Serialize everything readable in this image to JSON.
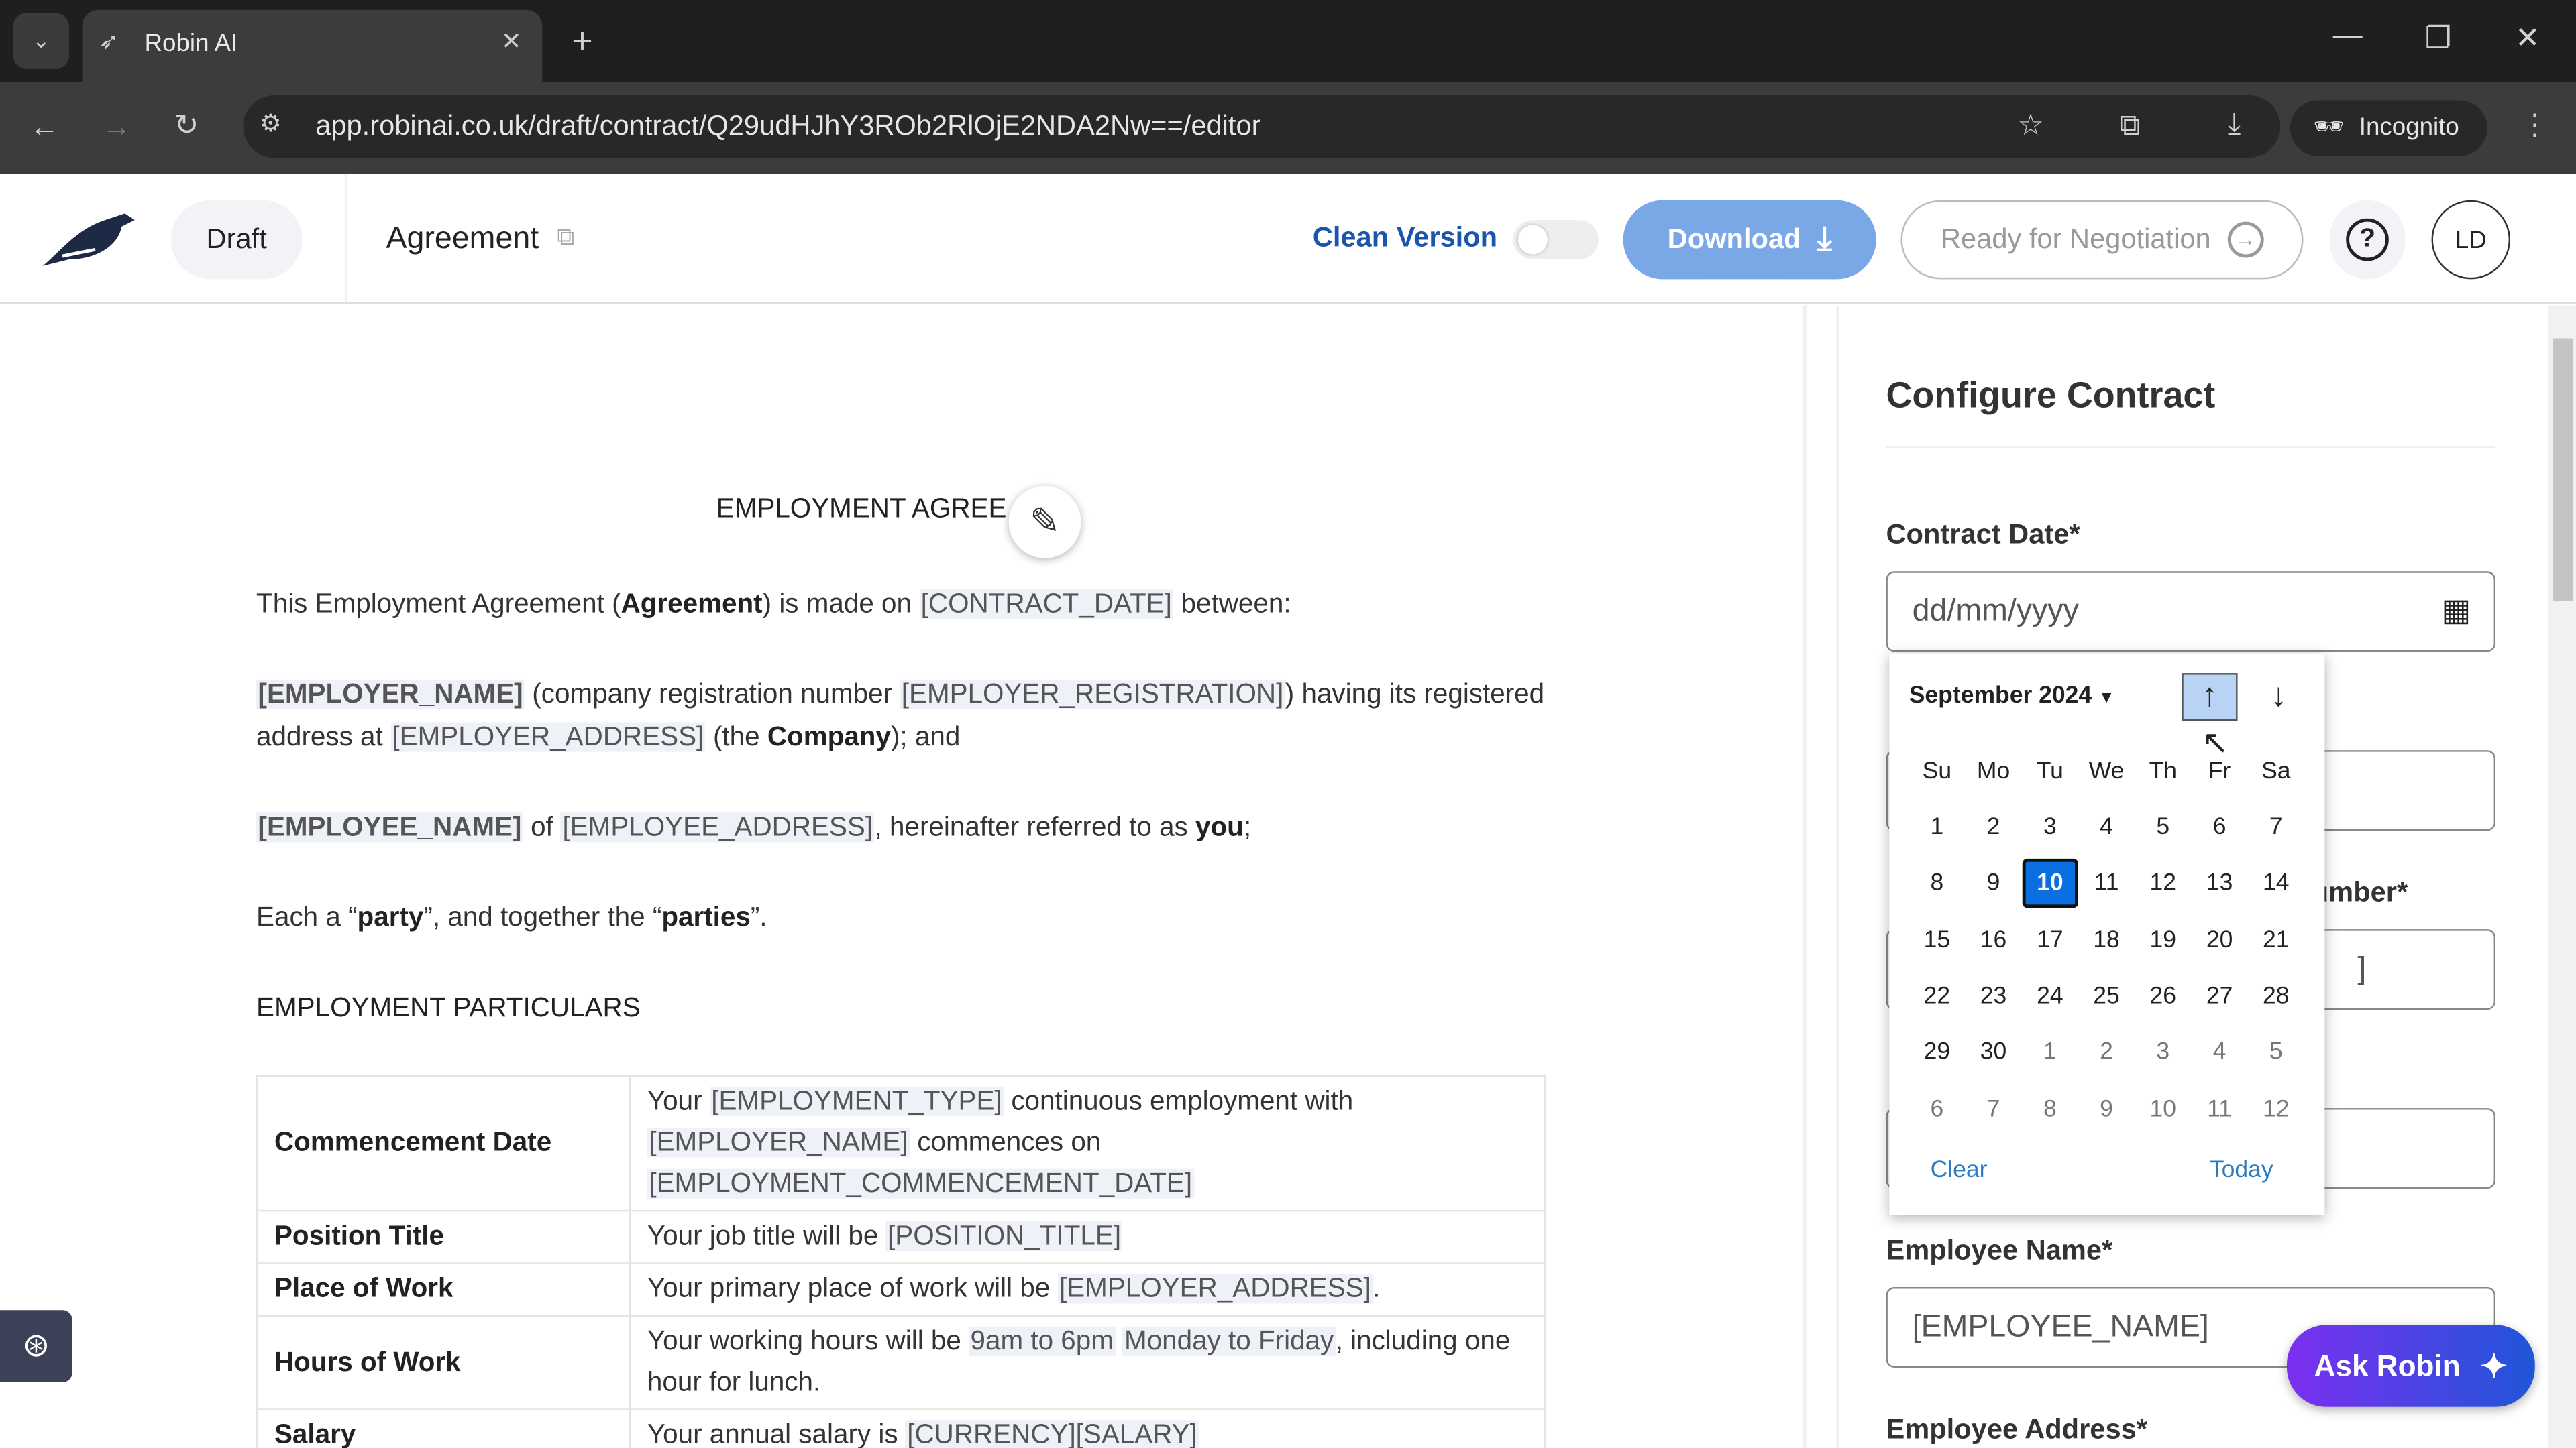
{
  "browser": {
    "tab_title": "Robin AI",
    "url": "app.robinai.co.uk/draft/contract/Q29udHJhY3ROb2RlOjE2NDA2Nw==/editor",
    "incognito_label": "Incognito"
  },
  "header": {
    "status": "Draft",
    "doc_title": "Agreement",
    "clean_version_label": "Clean Version",
    "clean_version_on": false,
    "download_label": "Download",
    "ready_label": "Ready for Negotiation",
    "avatar": "LD",
    "accent": "#1a56b0"
  },
  "doc": {
    "title": "EMPLOYMENT AGREE",
    "paragraphs": [
      [
        {
          "t": "This Employment Agreement (",
          "s": ""
        },
        {
          "t": "Agreement",
          "s": "b"
        },
        {
          "t": ") is made on ",
          "s": ""
        },
        {
          "t": "[CONTRACT_DATE]",
          "s": "ph"
        },
        {
          "t": " between:",
          "s": ""
        }
      ],
      [
        {
          "t": "[EMPLOYER_NAME]",
          "s": "b ph"
        },
        {
          "t": " (company registration number ",
          "s": ""
        },
        {
          "t": "[EMPLOYER_REGISTRATION]",
          "s": "ph"
        },
        {
          "t": ") having its registered address at ",
          "s": ""
        },
        {
          "t": "[EMPLOYER_ADDRESS]",
          "s": "ph"
        },
        {
          "t": " (the ",
          "s": ""
        },
        {
          "t": "Company",
          "s": "b"
        },
        {
          "t": "); and",
          "s": ""
        }
      ],
      [
        {
          "t": "[EMPLOYEE_NAME]",
          "s": "b ph"
        },
        {
          "t": " of ",
          "s": ""
        },
        {
          "t": "[EMPLOYEE_ADDRESS]",
          "s": "ph"
        },
        {
          "t": ", hereinafter referred to as ",
          "s": ""
        },
        {
          "t": "you",
          "s": "b"
        },
        {
          "t": ";",
          "s": ""
        }
      ],
      [
        {
          "t": "Each a “",
          "s": ""
        },
        {
          "t": "party",
          "s": "b"
        },
        {
          "t": "”, and together the “",
          "s": ""
        },
        {
          "t": "parties",
          "s": "b"
        },
        {
          "t": "”.",
          "s": ""
        }
      ],
      [
        {
          "t": "EMPLOYMENT PARTICULARS",
          "s": ""
        }
      ]
    ],
    "table": [
      {
        "k": "Commencement Date",
        "v": [
          {
            "t": "Your ",
            "s": ""
          },
          {
            "t": "[EMPLOYMENT_TYPE]",
            "s": "ph"
          },
          {
            "t": " continuous employment with ",
            "s": ""
          },
          {
            "t": "[EMPLOYER_NAME]",
            "s": "ph"
          },
          {
            "t": " commences on ",
            "s": ""
          },
          {
            "t": "[EMPLOYMENT_COMMENCEMENT_DATE]",
            "s": "ph"
          }
        ]
      },
      {
        "k": "Position Title",
        "v": [
          {
            "t": "Your job title will be ",
            "s": ""
          },
          {
            "t": "[POSITION_TITLE]",
            "s": "ph"
          }
        ]
      },
      {
        "k": "Place of Work",
        "v": [
          {
            "t": "Your primary place of work will be ",
            "s": ""
          },
          {
            "t": "[EMPLOYER_ADDRESS]",
            "s": "ph"
          },
          {
            "t": ".",
            "s": ""
          }
        ]
      },
      {
        "k": "Hours of Work",
        "v": [
          {
            "t": "Your working hours will be ",
            "s": ""
          },
          {
            "t": "9am to 6pm",
            "s": "ph"
          },
          {
            "t": " ",
            "s": ""
          },
          {
            "t": "Monday to Friday",
            "s": "ph"
          },
          {
            "t": ", including one hour for lunch.",
            "s": ""
          }
        ]
      },
      {
        "k": "Salary",
        "v": [
          {
            "t": "Your annual salary is ",
            "s": ""
          },
          {
            "t": "[CURRENCY][SALARY]",
            "s": "ph"
          }
        ]
      }
    ]
  },
  "panel": {
    "title": "Configure Contract",
    "contract_date_label": "Contract Date*",
    "contract_date_placeholder": "dd/mm/yyyy",
    "partial_label": "umber*",
    "partial_value": "]",
    "employee_name_label": "Employee Name*",
    "employee_name_value": "[EMPLOYEE_NAME]",
    "employee_address_label": "Employee Address*"
  },
  "calendar": {
    "month_label": "September 2024",
    "weekdays": [
      "Su",
      "Mo",
      "Tu",
      "We",
      "Th",
      "Fr",
      "Sa"
    ],
    "days": [
      "1",
      "2",
      "3",
      "4",
      "5",
      "6",
      "7",
      "8",
      "9",
      "10",
      "11",
      "12",
      "13",
      "14",
      "15",
      "16",
      "17",
      "18",
      "19",
      "20",
      "21",
      "22",
      "23",
      "24",
      "25",
      "26",
      "27",
      "28",
      "29",
      "30",
      "1",
      "2",
      "3",
      "4",
      "5",
      "6",
      "7",
      "8",
      "9",
      "10",
      "11",
      "12"
    ],
    "current_month_count": 30,
    "selected": "10",
    "clear_label": "Clear",
    "today_label": "Today"
  },
  "ask_robin": {
    "label": "Ask Robin"
  }
}
